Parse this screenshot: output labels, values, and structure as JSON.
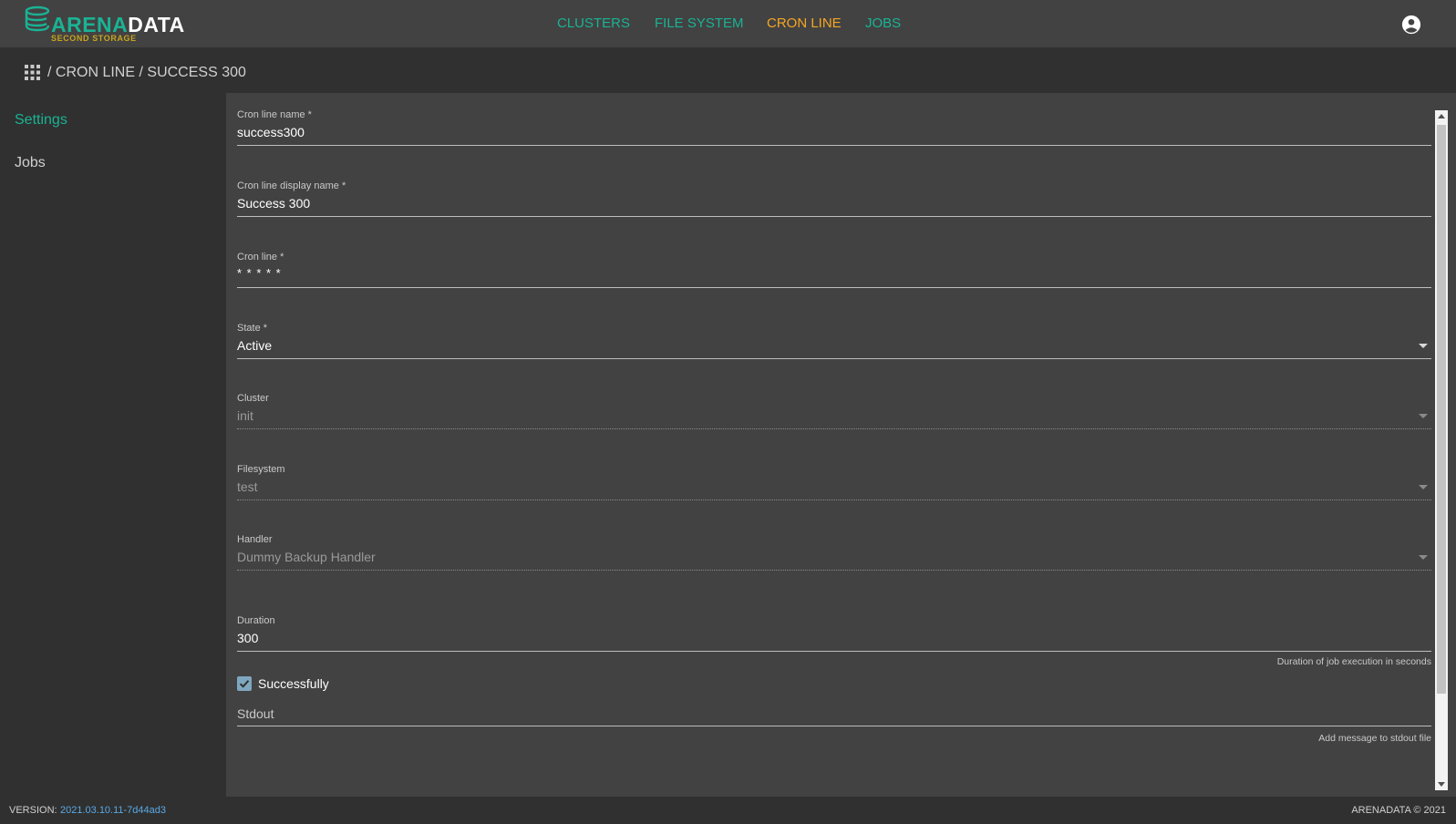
{
  "header": {
    "logo": {
      "word_part1": "ARENA",
      "word_part2": "DATA",
      "subtitle": "SECOND STORAGE"
    },
    "nav": [
      {
        "label": "CLUSTERS",
        "active": false
      },
      {
        "label": "FILE SYSTEM",
        "active": false
      },
      {
        "label": "CRON LINE",
        "active": true
      },
      {
        "label": "JOBS",
        "active": false
      }
    ],
    "user_icon": "account-circle-icon"
  },
  "breadcrumb": {
    "icon": "apps-grid-icon",
    "sep1": "/",
    "level1": "CRON LINE",
    "sep2": "/",
    "level2": "SUCCESS 300"
  },
  "sidebar": {
    "items": [
      {
        "label": "Settings",
        "active": true
      },
      {
        "label": "Jobs",
        "active": false
      }
    ]
  },
  "form": {
    "name": {
      "label": "Cron line name *",
      "value": "success300"
    },
    "display_name": {
      "label": "Cron line display name *",
      "value": "Success 300"
    },
    "cron_line": {
      "label": "Cron line *",
      "value": "* * * * *"
    },
    "state": {
      "label": "State *",
      "value": "Active"
    },
    "cluster": {
      "label": "Cluster",
      "value": "init"
    },
    "filesystem": {
      "label": "Filesystem",
      "value": "test"
    },
    "handler": {
      "label": "Handler",
      "value": "Dummy Backup Handler"
    },
    "duration": {
      "label": "Duration",
      "value": "300",
      "hint": "Duration of job execution in seconds"
    },
    "successfully": {
      "label": "Successfully",
      "checked": true
    },
    "stdout": {
      "placeholder": "Stdout",
      "hint": "Add message to stdout file"
    }
  },
  "footer": {
    "version_label": "VERSION:",
    "version_value": "2021.03.10.11-7d44ad3",
    "copyright": "ARENADATA © 2021"
  },
  "colors": {
    "nav": "#1ab394",
    "nav_active": "#f5a623",
    "sidebar_active": "#1ab394",
    "version_value": "#5aa9e6",
    "checkbox": "#7fa7bf"
  }
}
